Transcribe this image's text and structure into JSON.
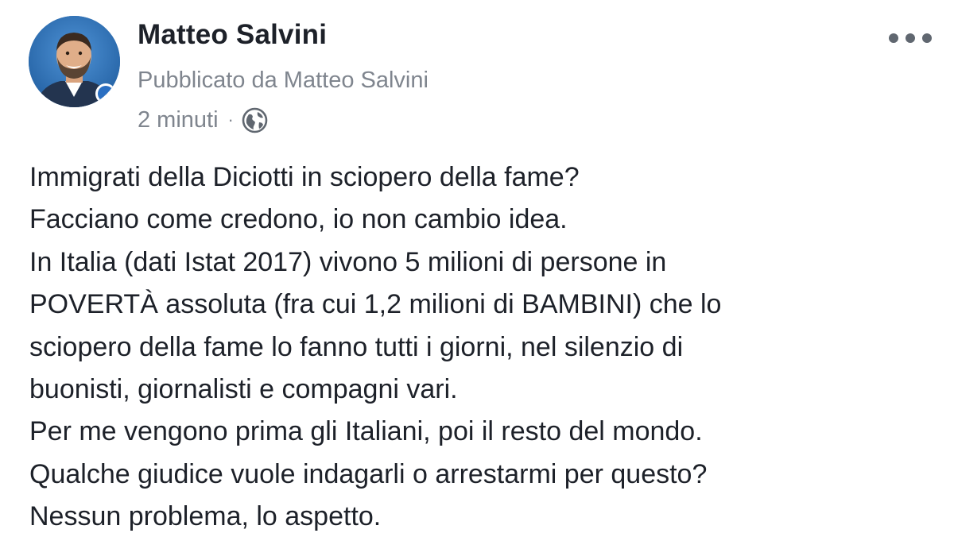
{
  "post": {
    "author_name": "Matteo Salvini",
    "published_by": "Pubblicato da Matteo Salvini",
    "timestamp": "2 minuti",
    "separator": "·",
    "audience_icon": "globe-icon",
    "more_icon": "more-options-icon",
    "text_lines": [
      "Immigrati della Diciotti in sciopero della fame?",
      "Facciano come credono, io non cambio idea.",
      "In Italia (dati Istat 2017) vivono 5 milioni di persone in",
      "POVERTÀ assoluta (fra cui 1,2 milioni di BAMBINI) che lo",
      "sciopero della fame lo fanno tutti i giorni, nel silenzio di",
      "buonisti, giornalisti e compagni vari.",
      "Per me vengono prima gli Italiani, poi il resto del mondo.",
      "Qualche giudice vuole indagarli o arrestarmi per questo?",
      "Nessun problema, lo aspetto."
    ]
  },
  "colors": {
    "text_primary": "#1d2129",
    "text_secondary": "#7f858e",
    "icon_gray": "#606770",
    "avatar_background": "#2f6fb4"
  }
}
